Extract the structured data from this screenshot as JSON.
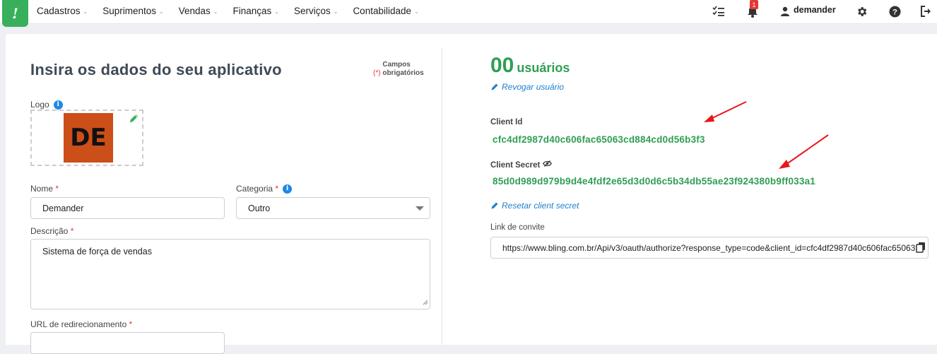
{
  "nav": {
    "logo": "!",
    "menu": [
      {
        "label": "Cadastros"
      },
      {
        "label": "Suprimentos"
      },
      {
        "label": "Vendas"
      },
      {
        "label": "Finanças"
      },
      {
        "label": "Serviços"
      },
      {
        "label": "Contabilidade"
      }
    ],
    "notifications_count": "1",
    "user": "demander",
    "icons": [
      "tasks-icon",
      "bell-icon",
      "user-icon",
      "gear-icon",
      "help-icon",
      "logout-icon"
    ]
  },
  "form": {
    "title": "Insira os dados do seu aplicativo",
    "required_mark": "(*)",
    "required_text": "Campos obrigatórios",
    "logo_label": "Logo",
    "logo_text": "DE",
    "name_label": "Nome",
    "name_value": "Demander",
    "category_label": "Categoria",
    "category_value": "Outro",
    "description_label": "Descrição",
    "description_value": "Sistema de força de vendas",
    "redirect_label": "URL de redirecionamento",
    "required_star": "*"
  },
  "app": {
    "users_count": "00",
    "users_word": "usuários",
    "revoke_label": "Revogar usuário",
    "client_id_label": "Client Id",
    "client_id": "cfc4df2987d40c606fac65063cd884cd0d56b3f3",
    "client_secret_label": "Client Secret",
    "client_secret": "85d0d989d979b9d4e4fdf2e65d3d0d6c5b34db55ae23f924380b9ff033a1",
    "reset_secret_label": "Resetar client secret",
    "invite_label": "Link de convite",
    "invite_link": "https://www.bling.com.br/Api/v3/oauth/authorize?response_type=code&client_id=cfc4df2987d40c606fac65063"
  },
  "colors": {
    "brand_green": "#38b05b",
    "value_green": "#2f9e54",
    "link_blue": "#1e7fce",
    "required_red": "#e53935",
    "annotation_red": "#e8171b"
  }
}
